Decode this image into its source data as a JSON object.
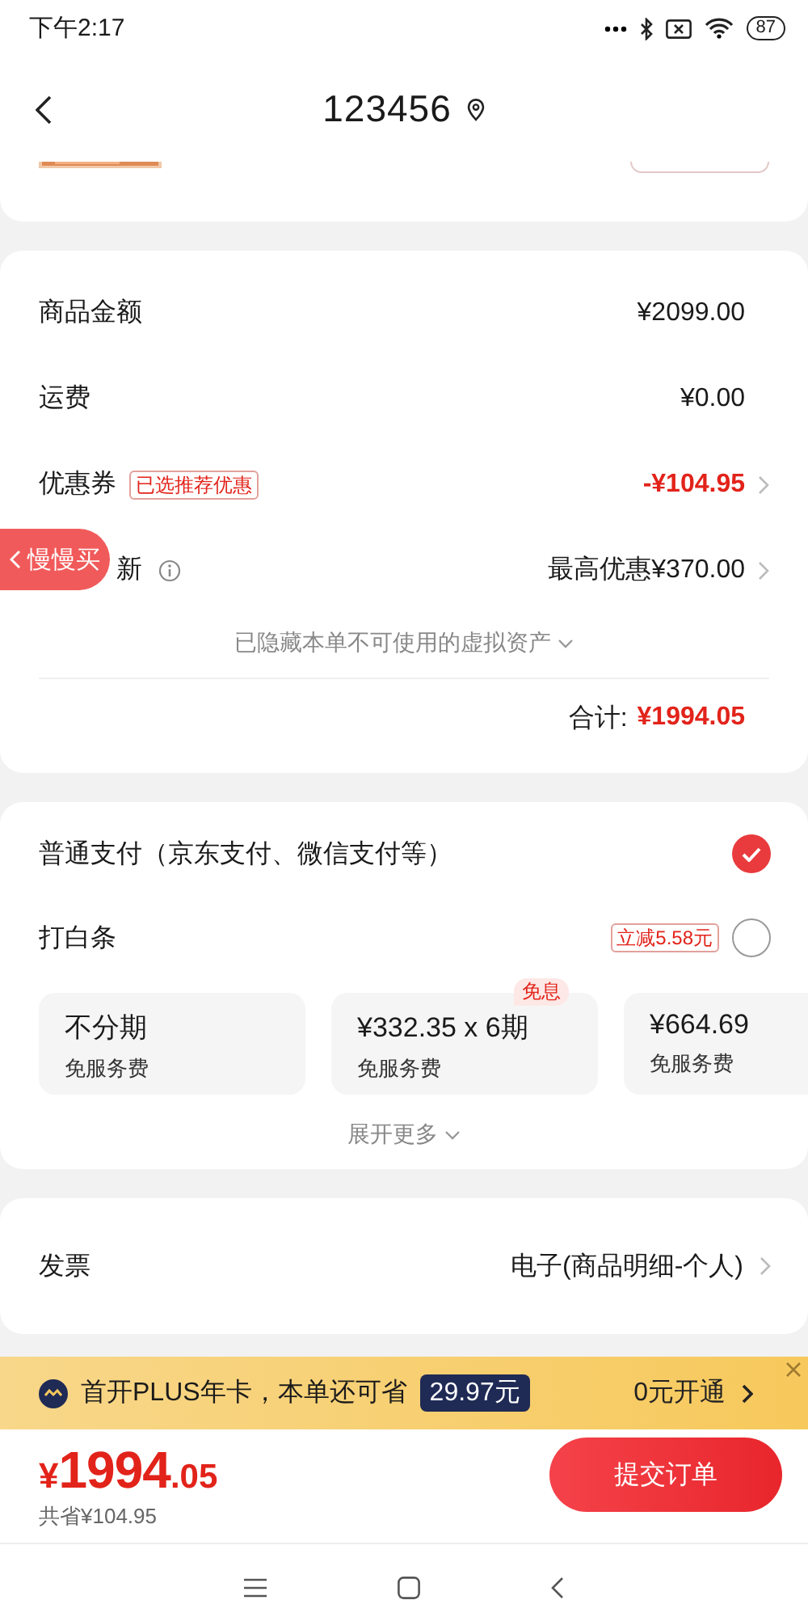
{
  "status_bar": {
    "time": "下午2:17",
    "battery": "87"
  },
  "nav": {
    "title": "123456"
  },
  "summary": {
    "rows": [
      {
        "kind": "amount",
        "label": "商品金额",
        "value": "¥2099.00"
      },
      {
        "kind": "amount",
        "label": "运费",
        "value": "¥0.00"
      },
      {
        "kind": "coupon",
        "label": "优惠券",
        "tag": "已选推荐优惠",
        "value": "-¥104.95"
      },
      {
        "kind": "tradein",
        "label": "新",
        "value": "最高优惠¥370.00"
      }
    ],
    "hidden_note": "已隐藏本单不可使用的虚拟资产",
    "total_label": "合计:",
    "total": "¥1994.05"
  },
  "float_tab": {
    "label": "慢慢买"
  },
  "payment": {
    "methods": [
      {
        "label": "普通支付（京东支付、微信支付等）",
        "selected": true
      },
      {
        "label": "打白条",
        "tag": "立减5.58元",
        "selected": false
      }
    ],
    "installments": [
      {
        "title": "不分期",
        "note": "免服务费"
      },
      {
        "title": "¥332.35 x 6期",
        "note": "免服务费",
        "badge": "免息"
      },
      {
        "title": "¥664.69",
        "note": "免服务费"
      }
    ],
    "expand": "展开更多"
  },
  "invoice": {
    "label": "发票",
    "value": "电子(商品明细-个人)"
  },
  "plus_banner": {
    "text": "首开PLUS年卡，本单还可省",
    "amount": "29.97元",
    "action": "0元开通"
  },
  "footer": {
    "price_symbol": "¥",
    "price_int": "1994",
    "price_dec": ".05",
    "saved": "共省¥104.95",
    "submit": "提交订单"
  }
}
